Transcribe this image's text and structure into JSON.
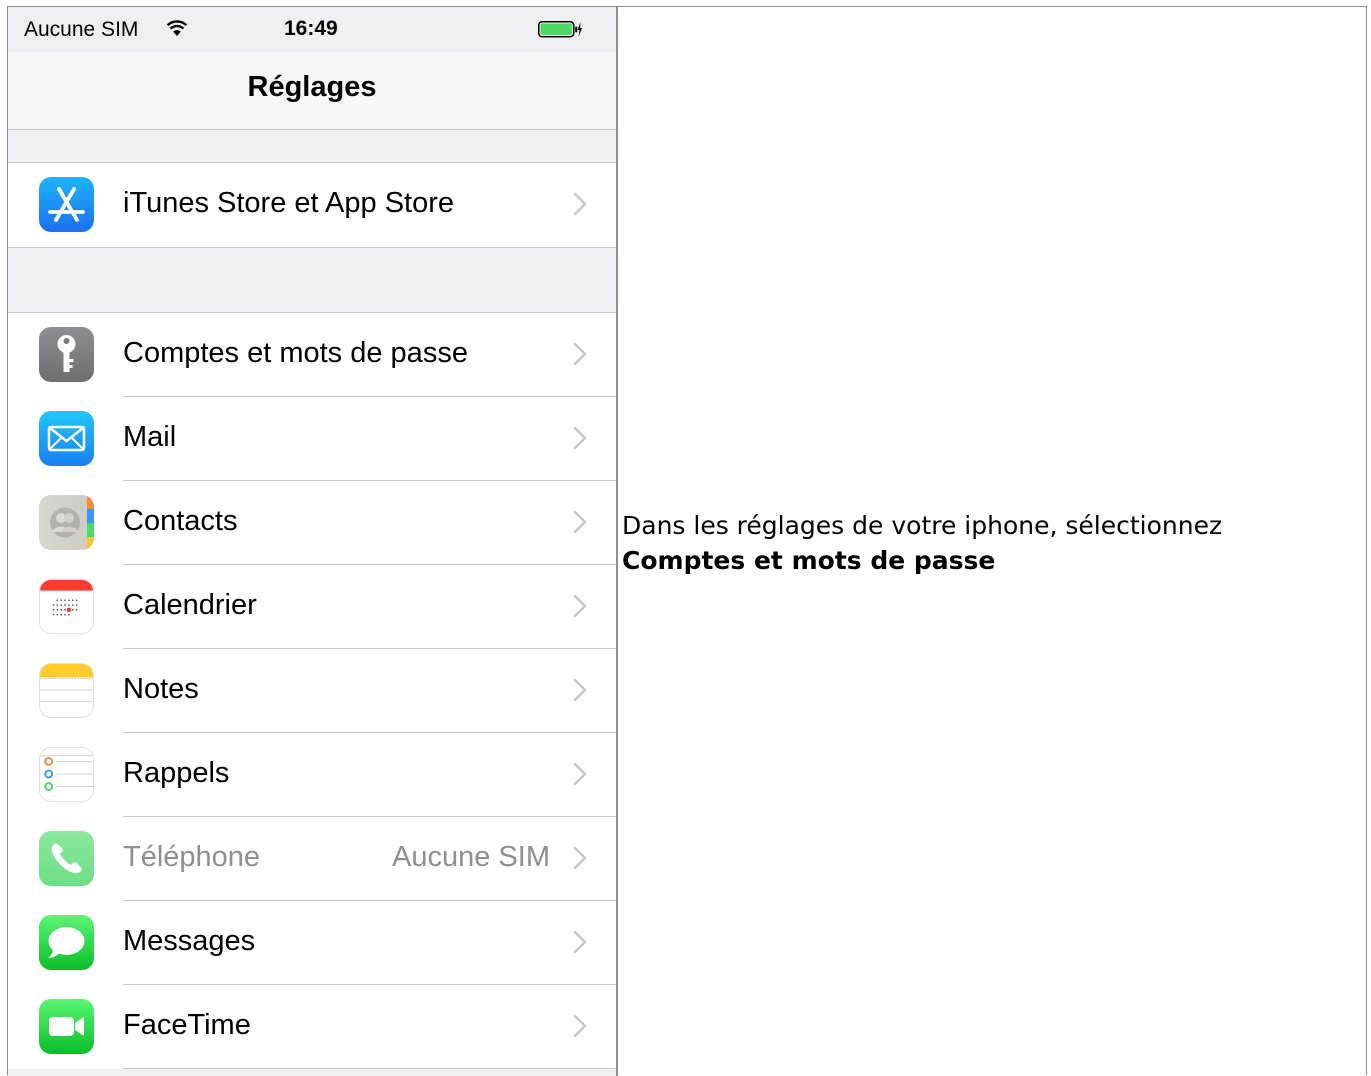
{
  "status_bar": {
    "carrier": "Aucune SIM",
    "time": "16:49"
  },
  "nav": {
    "title": "Réglages"
  },
  "group1": [
    {
      "label": "iTunes Store et App Store",
      "icon": "app-store-icon"
    }
  ],
  "group2": [
    {
      "label": "Comptes et mots de passe",
      "icon": "key-icon"
    },
    {
      "label": "Mail",
      "icon": "mail-icon"
    },
    {
      "label": "Contacts",
      "icon": "contacts-icon"
    },
    {
      "label": "Calendrier",
      "icon": "calendar-icon"
    },
    {
      "label": "Notes",
      "icon": "notes-icon"
    },
    {
      "label": "Rappels",
      "icon": "reminders-icon"
    },
    {
      "label": "Téléphone",
      "value": "Aucune SIM",
      "icon": "phone-icon"
    },
    {
      "label": "Messages",
      "icon": "messages-icon"
    },
    {
      "label": "FaceTime",
      "icon": "facetime-icon"
    }
  ],
  "instruction": {
    "text": "Dans les réglages de votre iphone, sélectionnez",
    "bold": "Comptes et mots de passe"
  },
  "colors": {
    "battery_green": "#4cd964",
    "app_store_blue": "#1a8cf5",
    "chevron": "#c7c7cc"
  }
}
